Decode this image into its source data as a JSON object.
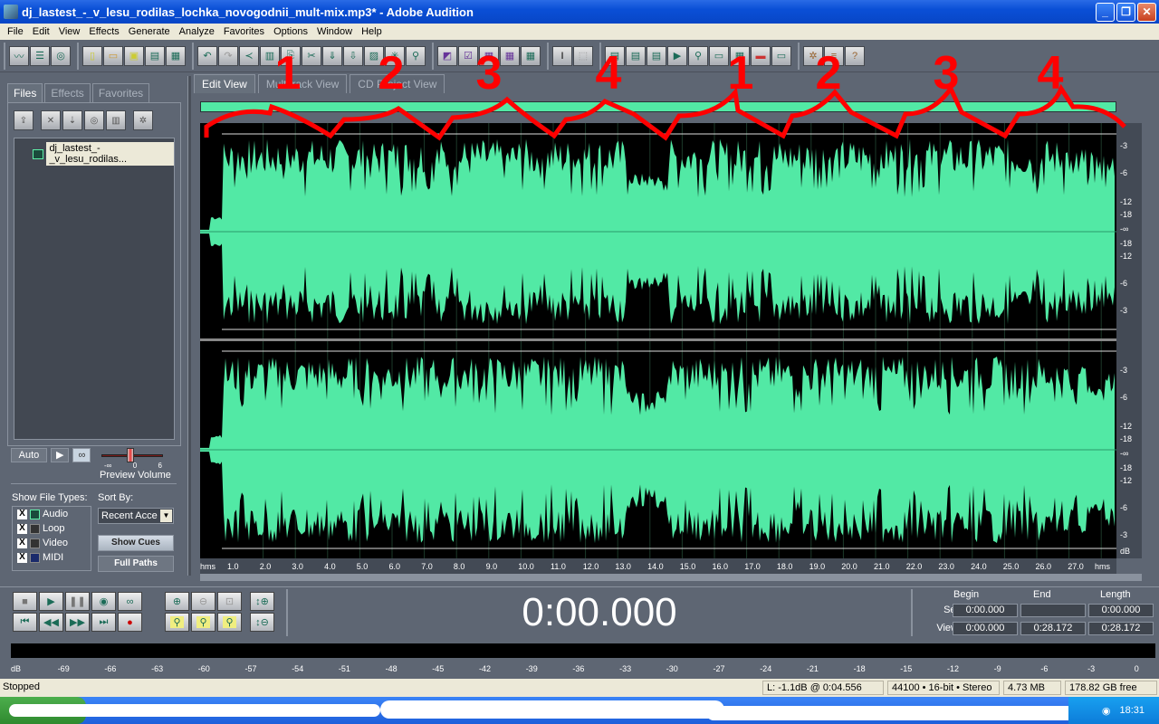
{
  "window": {
    "title": "dj_lastest_-_v_lesu_rodilas_lochka_novogodnii_mult-mix.mp3* - Adobe Audition",
    "buttons": [
      "minimize",
      "restore",
      "close"
    ]
  },
  "menu": [
    "File",
    "Edit",
    "View",
    "Effects",
    "Generate",
    "Analyze",
    "Favorites",
    "Options",
    "Window",
    "Help"
  ],
  "toolbar": {
    "groups": [
      [
        "edit-view-icon",
        "multitrack-view-icon",
        "cd-view-icon"
      ],
      [
        "new-file-icon",
        "open-file-icon",
        "save-icon",
        "save-as-icon",
        "save-all-icon"
      ],
      [
        "undo-icon",
        "redo-icon",
        "repeat-icon",
        "mix-paste-icon",
        "copy-icon",
        "cut-icon",
        "paste-icon",
        "paste-new-icon",
        "trim-icon",
        "insert-cue-icon",
        "cue-list-icon"
      ],
      [
        "spectral-view-icon",
        "checkbox-icon",
        "show-grid-icon",
        "frequency-icon",
        "waveform-icon"
      ],
      [
        "time-selection-tool-icon",
        "marquee-tool-icon"
      ],
      [
        "info-icon",
        "playlist-icon",
        "edit-list-icon",
        "play-icon",
        "zoom-icon",
        "time-icon",
        "grid-icon",
        "level-icon",
        "blank-icon"
      ],
      [
        "settings-icon",
        "script-icon",
        "help-icon"
      ]
    ]
  },
  "left_panel": {
    "tabs": [
      "Files",
      "Effects",
      "Favorites"
    ],
    "active_tab": "Files",
    "icons": [
      "import-icon",
      "close-file-icon",
      "insert-into-multitrack-icon",
      "insert-cd-icon",
      "edit-file-icon",
      "settings-icon"
    ],
    "files": [
      "dj_lastest_-_v_lesu_rodilas..."
    ],
    "preview": {
      "auto_label": "Auto",
      "play_label": "▶",
      "loop_label": "∞",
      "volume_label": "Preview Volume",
      "scale": [
        "-∞",
        "0",
        "6"
      ]
    },
    "show_file_types_label": "Show File Types:",
    "file_types": [
      {
        "label": "Audio",
        "checked": true
      },
      {
        "label": "Loop",
        "checked": true
      },
      {
        "label": "Video",
        "checked": true
      },
      {
        "label": "MIDI",
        "checked": true
      }
    ],
    "sort_by_label": "Sort By:",
    "sort_value": "Recent Acce",
    "show_cues_label": "Show Cues",
    "full_paths_label": "Full Paths"
  },
  "main_tabs": [
    "Edit View",
    "Multitrack View",
    "CD Project View"
  ],
  "active_main_tab": "Edit View",
  "db_scale": {
    "top_channel": [
      "-3",
      "-6",
      "-12",
      "-18",
      "-∞",
      "-18",
      "-12",
      "-6",
      "-3"
    ],
    "bottom_channel": [
      "-3",
      "-6",
      "-12",
      "-18",
      "-∞",
      "-18",
      "-12",
      "-6",
      "-3"
    ],
    "unit": "dB"
  },
  "time_ruler": {
    "unit": "hms",
    "ticks": [
      "1.0",
      "2.0",
      "3.0",
      "4.0",
      "5.0",
      "6.0",
      "7.0",
      "8.0",
      "9.0",
      "10.0",
      "11.0",
      "12.0",
      "13.0",
      "14.0",
      "15.0",
      "16.0",
      "17.0",
      "18.0",
      "19.0",
      "20.0",
      "21.0",
      "22.0",
      "23.0",
      "24.0",
      "25.0",
      "26.0",
      "27.0"
    ]
  },
  "annotations": {
    "color": "#ff0000",
    "labels": [
      "1",
      "2",
      "3",
      "4",
      "1",
      "2",
      "3",
      "4"
    ]
  },
  "transport": {
    "buttons": [
      "stop-icon",
      "play-icon",
      "pause-icon",
      "play-to-end-icon",
      "loop-icon",
      "go-to-start-icon",
      "rewind-icon",
      "fast-forward-icon",
      "go-to-end-icon",
      "record-icon"
    ],
    "zoom_buttons": [
      "zoom-in-icon",
      "zoom-out-icon",
      "zoom-full-icon",
      "zoom-selection-left-icon",
      "zoom-selection-icon",
      "zoom-selection-right-icon",
      "zoom-in-vertical-icon",
      "zoom-out-vertical-icon"
    ],
    "time": "0:00.000"
  },
  "selection": {
    "headers": [
      "Begin",
      "End",
      "Length"
    ],
    "sel_label": "Sel",
    "view_label": "View",
    "sel": {
      "begin": "0:00.000",
      "end": "",
      "length": "0:00.000"
    },
    "view": {
      "begin": "0:00.000",
      "end": "0:28.172",
      "length": "0:28.172"
    }
  },
  "level_meter": {
    "scale": [
      "dB",
      "-69",
      "-66",
      "-63",
      "-60",
      "-57",
      "-54",
      "-51",
      "-48",
      "-45",
      "-42",
      "-39",
      "-36",
      "-33",
      "-30",
      "-27",
      "-24",
      "-21",
      "-18",
      "-15",
      "-12",
      "-9",
      "-6",
      "-3",
      "0"
    ]
  },
  "status": {
    "state": "Stopped",
    "level": "L: -1.1dB @  0:04.556",
    "format": "44100 • 16-bit • Stereo",
    "size": "4.73 MB",
    "free": "178.82 GB free"
  },
  "taskbar": {
    "clock": "18:31"
  },
  "colors": {
    "waveform": "#52e9a5",
    "panel": "#5e6673",
    "annotation": "#ff0000"
  }
}
